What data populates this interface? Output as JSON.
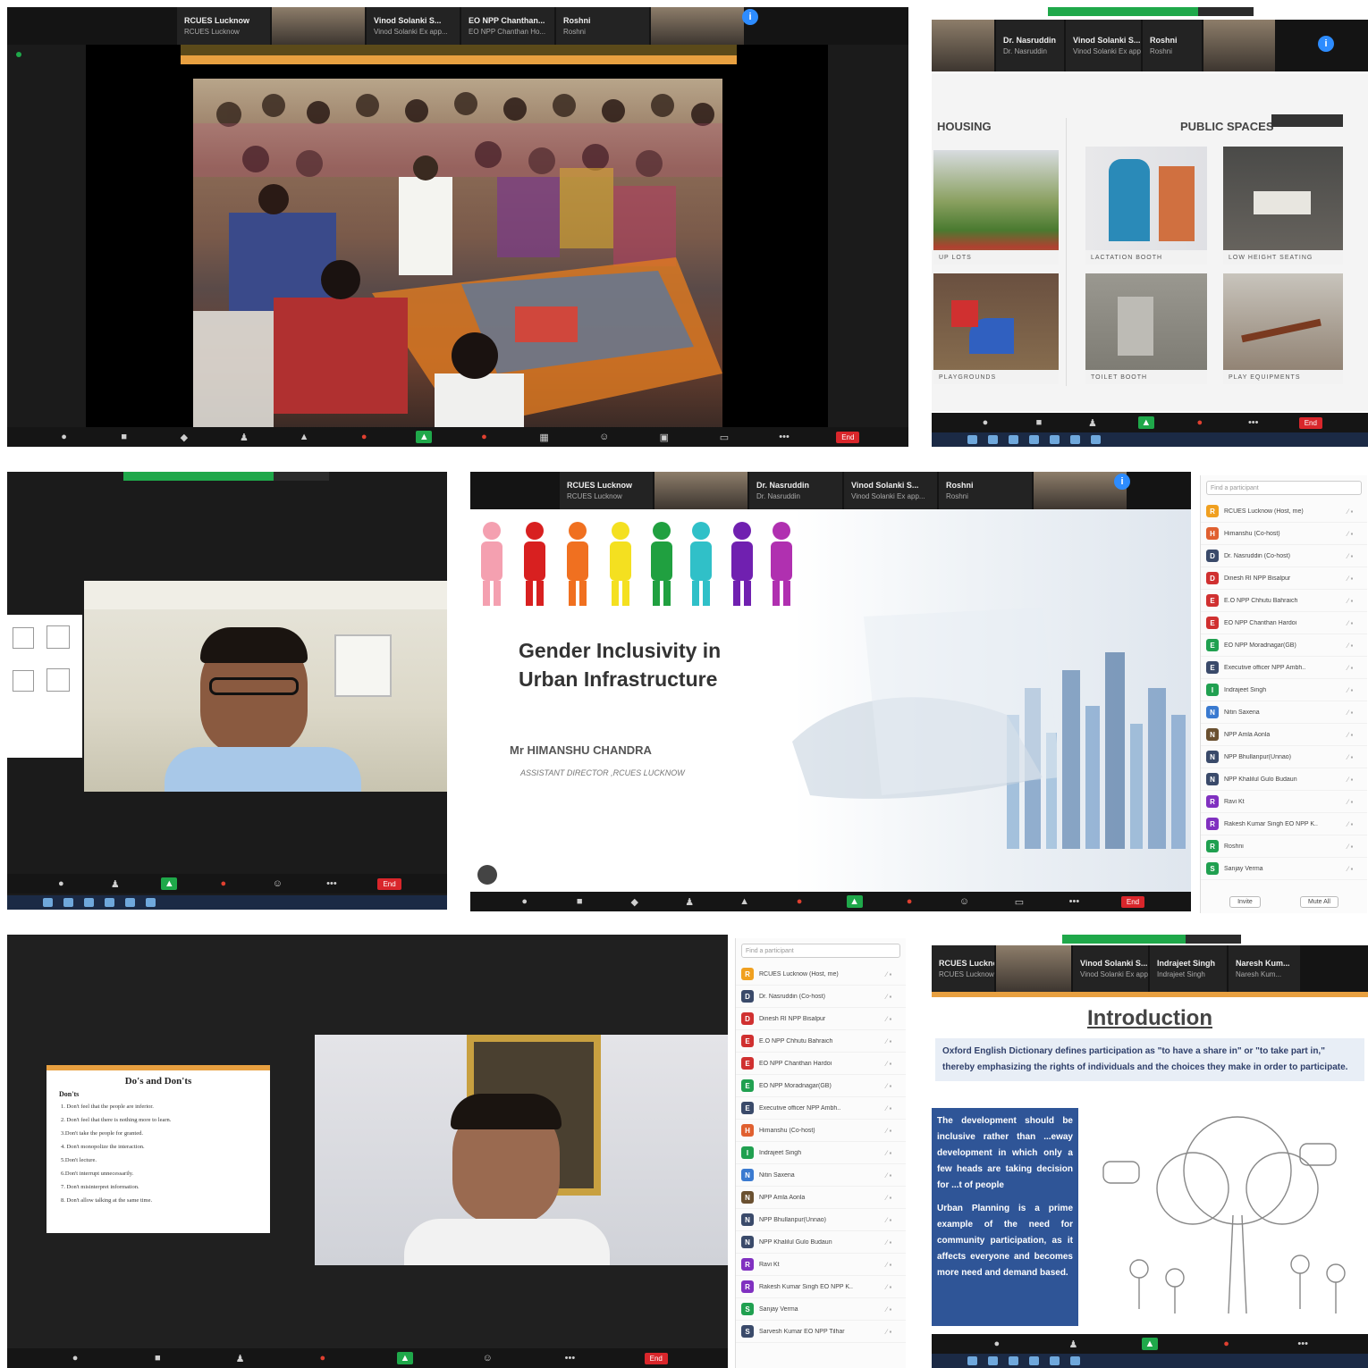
{
  "zoom_strip": {
    "tiles": [
      {
        "name": "RCUES Lucknow",
        "sub": "RCUES Lucknow"
      },
      {
        "name": "Vinod Solanki S...",
        "sub": "Vinod Solanki Ex app..."
      },
      {
        "name": "EO NPP Chanthan...",
        "sub": "EO NPP Chanthan Ho..."
      },
      {
        "name": "Roshni",
        "sub": "Roshni"
      }
    ],
    "tiles_b": [
      {
        "name": "Dr. Nasruddin",
        "sub": "Dr. Nasruddin"
      },
      {
        "name": "Vinod Solanki S...",
        "sub": "Vinod Solanki Ex app..."
      },
      {
        "name": "Roshni",
        "sub": "Roshni"
      }
    ],
    "tiles_d": [
      {
        "name": "RCUES Lucknow",
        "sub": "RCUES Lucknow"
      },
      {
        "name": "Vinod Solanki S...",
        "sub": "Vinod Solanki Ex app..."
      },
      {
        "name": "Indrajeet Singh",
        "sub": "Indrajeet Singh"
      },
      {
        "name": "Naresh Kum...",
        "sub": "Naresh Kum..."
      }
    ],
    "end_label": "End"
  },
  "slide_public_spaces": {
    "left_heading": "HOUSING",
    "right_heading": "PUBLIC SPACES",
    "captions": [
      "UP LOTS",
      "LACTATION BOOTH",
      "LOW HEIGHT SEATING",
      "PLAYGROUNDS",
      "TOILET BOOTH",
      "PLAY EQUIPMENTS"
    ]
  },
  "main_slide": {
    "title_line1": "Gender Inclusivity in",
    "title_line2": "Urban Infrastructure",
    "presenter": "Mr HIMANSHU CHANDRA",
    "designation": "ASSISTANT DIRECTOR ,RCUES LUCKNOW"
  },
  "participants": {
    "search_placeholder": "Find a participant",
    "list": [
      {
        "initial": "R",
        "name": "RCUES Lucknow (Host, me)",
        "color": "#f0a020"
      },
      {
        "initial": "H",
        "name": "Himanshu (Co-host)",
        "color": "#e06030"
      },
      {
        "initial": "D",
        "name": "Dr. Nasruddin (Co-host)",
        "color": "#3a4a6a"
      },
      {
        "initial": "D",
        "name": "Dinesh RI NPP Bisalpur",
        "color": "#d03030"
      },
      {
        "initial": "E",
        "name": "E.O NPP Chhutu Bahraich",
        "color": "#d03030"
      },
      {
        "initial": "E",
        "name": "EO NPP Chanthan Hardoi",
        "color": "#d03030"
      },
      {
        "initial": "E",
        "name": "EO NPP Moradnagar(GB)",
        "color": "#20a050"
      },
      {
        "initial": "E",
        "name": "Executive officer NPP Ambh..",
        "color": "#3a4a6a"
      },
      {
        "initial": "I",
        "name": "Indrajeet Singh",
        "color": "#20a050"
      },
      {
        "initial": "N",
        "name": "Nitin Saxena",
        "color": "#3a7ad0"
      },
      {
        "initial": "N",
        "name": "NPP Amla Aonla",
        "color": "#6a5030"
      },
      {
        "initial": "N",
        "name": "NPP Bhullanpur(Unnao)",
        "color": "#3a4a6a"
      },
      {
        "initial": "N",
        "name": "NPP Khalilul Gulo Budaun",
        "color": "#3a4a6a"
      },
      {
        "initial": "R",
        "name": "Ravi Kt",
        "color": "#8030c0"
      },
      {
        "initial": "R",
        "name": "Rakesh Kumar Singh EO NPP K..",
        "color": "#8030c0"
      },
      {
        "initial": "R",
        "name": "Roshni",
        "color": "#20a050"
      },
      {
        "initial": "S",
        "name": "Sanjay Verma",
        "color": "#20a050"
      }
    ],
    "invite_label": "Invite",
    "mute_all_label": "Mute All"
  },
  "participants_e": {
    "list": [
      {
        "initial": "R",
        "name": "RCUES Lucknow (Host, me)",
        "color": "#f0a020"
      },
      {
        "initial": "D",
        "name": "Dr. Nasruddin (Co-host)",
        "color": "#3a4a6a"
      },
      {
        "initial": "D",
        "name": "Dinesh RI NPP Bisalpur",
        "color": "#d03030"
      },
      {
        "initial": "E",
        "name": "E.O NPP Chhutu Bahraich",
        "color": "#d03030"
      },
      {
        "initial": "E",
        "name": "EO NPP Chanthan Hardoi",
        "color": "#d03030"
      },
      {
        "initial": "E",
        "name": "EO NPP Moradnagar(GB)",
        "color": "#20a050"
      },
      {
        "initial": "E",
        "name": "Executive officer NPP Ambh..",
        "color": "#3a4a6a"
      },
      {
        "initial": "H",
        "name": "Himanshu (Co-host)",
        "color": "#e06030"
      },
      {
        "initial": "I",
        "name": "Indrajeet Singh",
        "color": "#20a050"
      },
      {
        "initial": "N",
        "name": "Nitin Saxena",
        "color": "#3a7ad0"
      },
      {
        "initial": "N",
        "name": "NPP Amla Aonla",
        "color": "#6a5030"
      },
      {
        "initial": "N",
        "name": "NPP Bhullanpur(Unnao)",
        "color": "#3a4a6a"
      },
      {
        "initial": "N",
        "name": "NPP Khalilul Gulo Budaun",
        "color": "#3a4a6a"
      },
      {
        "initial": "R",
        "name": "Ravi Kt",
        "color": "#8030c0"
      },
      {
        "initial": "R",
        "name": "Rakesh Kumar Singh EO NPP K..",
        "color": "#8030c0"
      },
      {
        "initial": "S",
        "name": "Sanjay Verma",
        "color": "#20a050"
      },
      {
        "initial": "S",
        "name": "Sarvesh Kumar EO NPP Tilhar",
        "color": "#3a4a6a"
      }
    ]
  },
  "dos_donts": {
    "title": "Do's and Don'ts",
    "subtitle": "Don'ts",
    "items": [
      "1. Don't feel that the people are inferior.",
      "2. Don't feel that there is nothing more to learn.",
      "3.Don't take the people for granted.",
      "4. Don't monopolize the interaction.",
      "5.Don't lecture.",
      "6.Don't interrupt unnecessarily.",
      "7. Don't misinterpret information.",
      "8. Don't allow talking at the same time."
    ]
  },
  "introduction_slide": {
    "title": "Introduction",
    "definition": "Oxford English Dictionary defines participation as \"to have a share in\" or \"to take part in,\" thereby emphasizing the rights of individuals and the choices they make in order to participate.",
    "box_text_1": "The development should be inclusive rather than ...eway development in which only a few heads are taking decision for ...t of people",
    "box_text_2": "Urban Planning is a prime example of the need for community participation, as it affects everyone and becomes more need and demand based."
  },
  "colors": {
    "zoom_dark": "#1b1b1b",
    "share_green": "#1fa84a",
    "end_red": "#d9262b",
    "intro_blue": "#2f5597",
    "slide_accent": "#c0392b"
  }
}
